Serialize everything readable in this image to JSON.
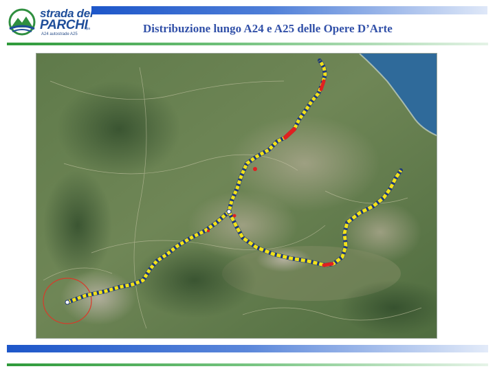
{
  "header": {
    "logo": {
      "name_line1": "strada dei",
      "name_line2": "PARCHI",
      "suffix": "spa",
      "subtitle": "A24 autostrade A25"
    },
    "title": "Distribuzione lungo A24 e A25 delle Opere D’Arte"
  },
  "colors": {
    "header_bar": "#1d56c9",
    "rule_green": "#2e9a3a",
    "title": "#3150a8",
    "route_marker": "#f2e21a",
    "route_dark": "#1e3a7a",
    "highlight_red": "#e02020"
  },
  "map": {
    "type": "satellite",
    "routes": [
      "A24",
      "A25"
    ],
    "icons": [
      "route-marker-icon",
      "red-segment-icon",
      "ring-road-icon"
    ]
  }
}
